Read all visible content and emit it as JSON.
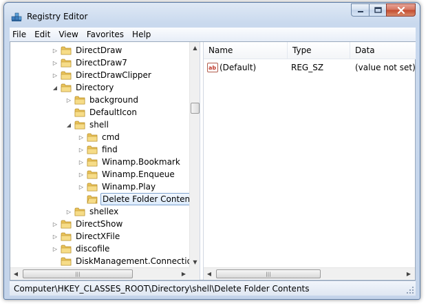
{
  "window": {
    "title": "Registry Editor"
  },
  "menu": [
    "File",
    "Edit",
    "View",
    "Favorites",
    "Help"
  ],
  "tree": [
    {
      "label": "DirectDraw",
      "expander": "collapsed"
    },
    {
      "label": "DirectDraw7",
      "expander": "collapsed"
    },
    {
      "label": "DirectDrawClipper",
      "expander": "collapsed"
    },
    {
      "label": "Directory",
      "expander": "expanded"
    },
    {
      "label": "background",
      "expander": "collapsed"
    },
    {
      "label": "DefaultIcon",
      "expander": "none"
    },
    {
      "label": "shell",
      "expander": "expanded"
    },
    {
      "label": "cmd",
      "expander": "collapsed"
    },
    {
      "label": "find",
      "expander": "collapsed"
    },
    {
      "label": "Winamp.Bookmark",
      "expander": "collapsed"
    },
    {
      "label": "Winamp.Enqueue",
      "expander": "collapsed"
    },
    {
      "label": "Winamp.Play",
      "expander": "collapsed"
    },
    {
      "label": "Delete Folder Contents",
      "expander": "none",
      "selected": true
    },
    {
      "label": "shellex",
      "expander": "collapsed"
    },
    {
      "label": "DirectShow",
      "expander": "collapsed"
    },
    {
      "label": "DirectXFile",
      "expander": "collapsed"
    },
    {
      "label": "discofile",
      "expander": "collapsed"
    },
    {
      "label": "DiskManagement.Connection",
      "expander": "none"
    }
  ],
  "list": {
    "columns": [
      "Name",
      "Type",
      "Data"
    ],
    "rows": [
      {
        "name": "(Default)",
        "type": "REG_SZ",
        "data": "(value not set)",
        "icon": "string-value-icon"
      }
    ]
  },
  "status": {
    "path": "Computer\\HKEY_CLASSES_ROOT\\Directory\\shell\\Delete Folder Contents"
  },
  "colors": {
    "folder": "#e8c25a",
    "selection_border": "#7da2ce",
    "close_button": "#c34a2e"
  }
}
